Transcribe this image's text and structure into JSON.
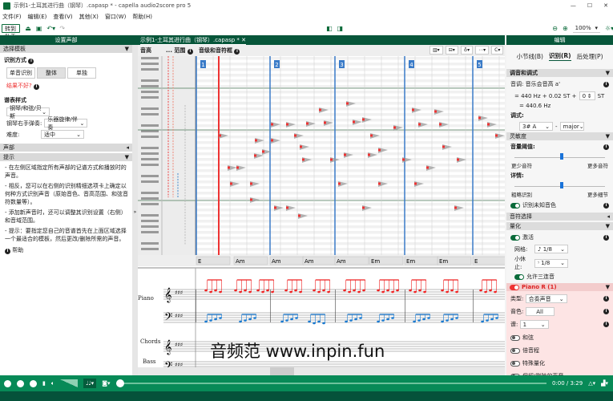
{
  "window": {
    "title": "示例1-土耳其进行曲（钢琴）.capasp * - capella audio2score pro 5",
    "controls": [
      "—",
      "☐",
      "✕"
    ]
  },
  "menu": [
    "文件(F)",
    "编辑(E)",
    "查看(V)",
    "其他(X)",
    "窗口(W)",
    "帮助(H)"
  ],
  "toolbar": {
    "wizard": "转到助手",
    "zoom": "100%"
  },
  "left": {
    "header": "设置声部",
    "template_section": "选择模板",
    "method_label": "识别方式",
    "methods": [
      "单音识别",
      "整体",
      "单独"
    ],
    "bad_result": "结果不好?",
    "style_label": "谱表样式",
    "style_value": "钢琴/和弦/贝斯",
    "right_hand_label": "钢琴右手弹奏:",
    "right_hand_value": "乐器旋律/伴奏",
    "difficulty_label": "难度:",
    "difficulty_value": "适中",
    "voices_section": "声部",
    "tips_section": "提示",
    "tips": [
      "- 在左侧区域指定所有声部的记谱方式和播放时的声音。",
      "- 相反，您可以在右侧的识别精细选项卡上确定以何种方式识别声音（原始音色、音高范围、和弦音符数量等）。",
      "- 添加新声音时，还可以调整其识别设置（右侧）和音域范围。",
      "- 提示：要指定您自己的音谱首先在上面区域选择一个最适合的模板，然后更改/删除所需的声音。"
    ],
    "help": "帮助"
  },
  "center": {
    "tab": "示例1-土耳其进行曲（钢琴）.capasp *",
    "col_headers": [
      "音高",
      "... 范围",
      "音级和音符框"
    ],
    "measures": [
      "1",
      "2",
      "3",
      "4",
      "5"
    ],
    "chords": [
      "E",
      "Am",
      "Am",
      "Am",
      "Am",
      "Em",
      "Em",
      "Em",
      "E"
    ],
    "staves": [
      "Piano",
      "Chords",
      "Bass"
    ],
    "watermark": "音频范 www.inpin.fun"
  },
  "right": {
    "header": "编辑",
    "tabs": [
      "小节线(B)",
      "识别(R)",
      "后处理(P)"
    ],
    "tuning_section": "调音和调式",
    "pitch_label": "音调: 音乐会音高 a'",
    "hz_line": "= 440 Hz + 0.02 ST +",
    "st_value": "0",
    "st_unit": "ST",
    "hz_result": "= 440.6 Hz",
    "mode_label": "调式:",
    "key_value": "3# A",
    "mode_value": "major",
    "sensitivity_section": "灵敏度",
    "threshold_label": "音量阈值:",
    "threshold_value": 0.5,
    "less_notes": "更少音符",
    "more_notes": "更多音符",
    "detail_label": "详情:",
    "detail_value": 0.5,
    "coarse": "粗略识别",
    "more_detail": "更多细节",
    "unknown_timbre": "识别未知音色",
    "note_select_section": "音符选择",
    "quantize_section": "量化",
    "activate": "激活",
    "grid_label": "网格:",
    "grid_value": "♪ 1/8",
    "rest_label": "小休止:",
    "rest_value": "𝄾 1/8",
    "triplets": "允许三连音",
    "voice_section": "Piano R (1)",
    "type_label": "类型:",
    "type_value": "合奏声音",
    "timbre_label": "音色:",
    "timbre_value": "All",
    "voice_label": "谱:",
    "voice_value": "1",
    "chord": "和弦",
    "octave": "倍音程",
    "special_quant": "特殊量化",
    "last": "保留/删除的声音"
  },
  "player": {
    "time": "0:00 / 3:29",
    "progress": 0.0
  },
  "colors": {
    "green": "#07563a",
    "accent_red": "#e33",
    "blue": "#1a73d9"
  }
}
